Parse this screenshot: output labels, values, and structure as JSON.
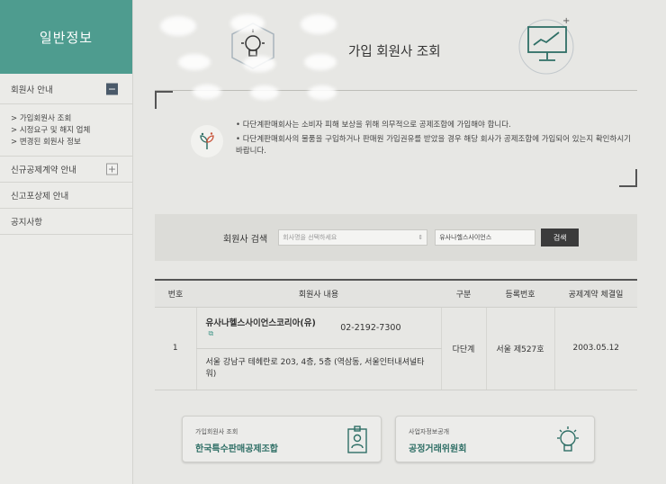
{
  "sidebar": {
    "title": "일반정보",
    "items": [
      {
        "label": "회원사 안내",
        "toggle": "−"
      },
      {
        "label": "신규공제계약 안내",
        "toggle": "+"
      },
      {
        "label": "신고포상제 안내"
      },
      {
        "label": "공지사항"
      }
    ],
    "subitems": [
      "> 가입회원사 조회",
      "> 시정요구 및 해지 업체",
      "> 변경된 회원사 정보"
    ]
  },
  "page": {
    "title": "가입 회원사 조회"
  },
  "notice": {
    "lines": [
      "다단계판매회사는 소비자 피해 보상을 위해 의무적으로 공제조합에 가입해야 합니다.",
      "다단계판매회사의 물품을 구입하거나 판매원 가입권유를 받았을 경우 해당 회사가 공제조합에 가입되어 있는지 확인하시기 바랍니다."
    ]
  },
  "search": {
    "label": "회원사 검색",
    "select_placeholder": "회사명을 선택하세요",
    "input_value": "유사나헬스사이언스",
    "button": "검색"
  },
  "table": {
    "headers": [
      "번호",
      "회원사 내용",
      "구분",
      "등록번호",
      "공제계약 체결일"
    ],
    "rows": [
      {
        "no": "1",
        "company": "유사나헬스사이언스코리아(유)",
        "phone": "02-2192-7300",
        "address": "서울 강남구 테헤란로 203, 4층, 5층 (역삼동, 서울인터내셔널타워)",
        "type": "다단계",
        "reg_no": "서울 제527호",
        "date": "2003.05.12"
      }
    ]
  },
  "cards": [
    {
      "sub": "가입회원사 조회",
      "main": "한국특수판매공제조합",
      "icon": "id-badge-icon"
    },
    {
      "sub": "사업자정보공개",
      "main": "공정거래위원회",
      "icon": "lightbulb-icon"
    }
  ],
  "colors": {
    "accent": "#4e9c8f",
    "dark_button": "#3b3b3b"
  }
}
